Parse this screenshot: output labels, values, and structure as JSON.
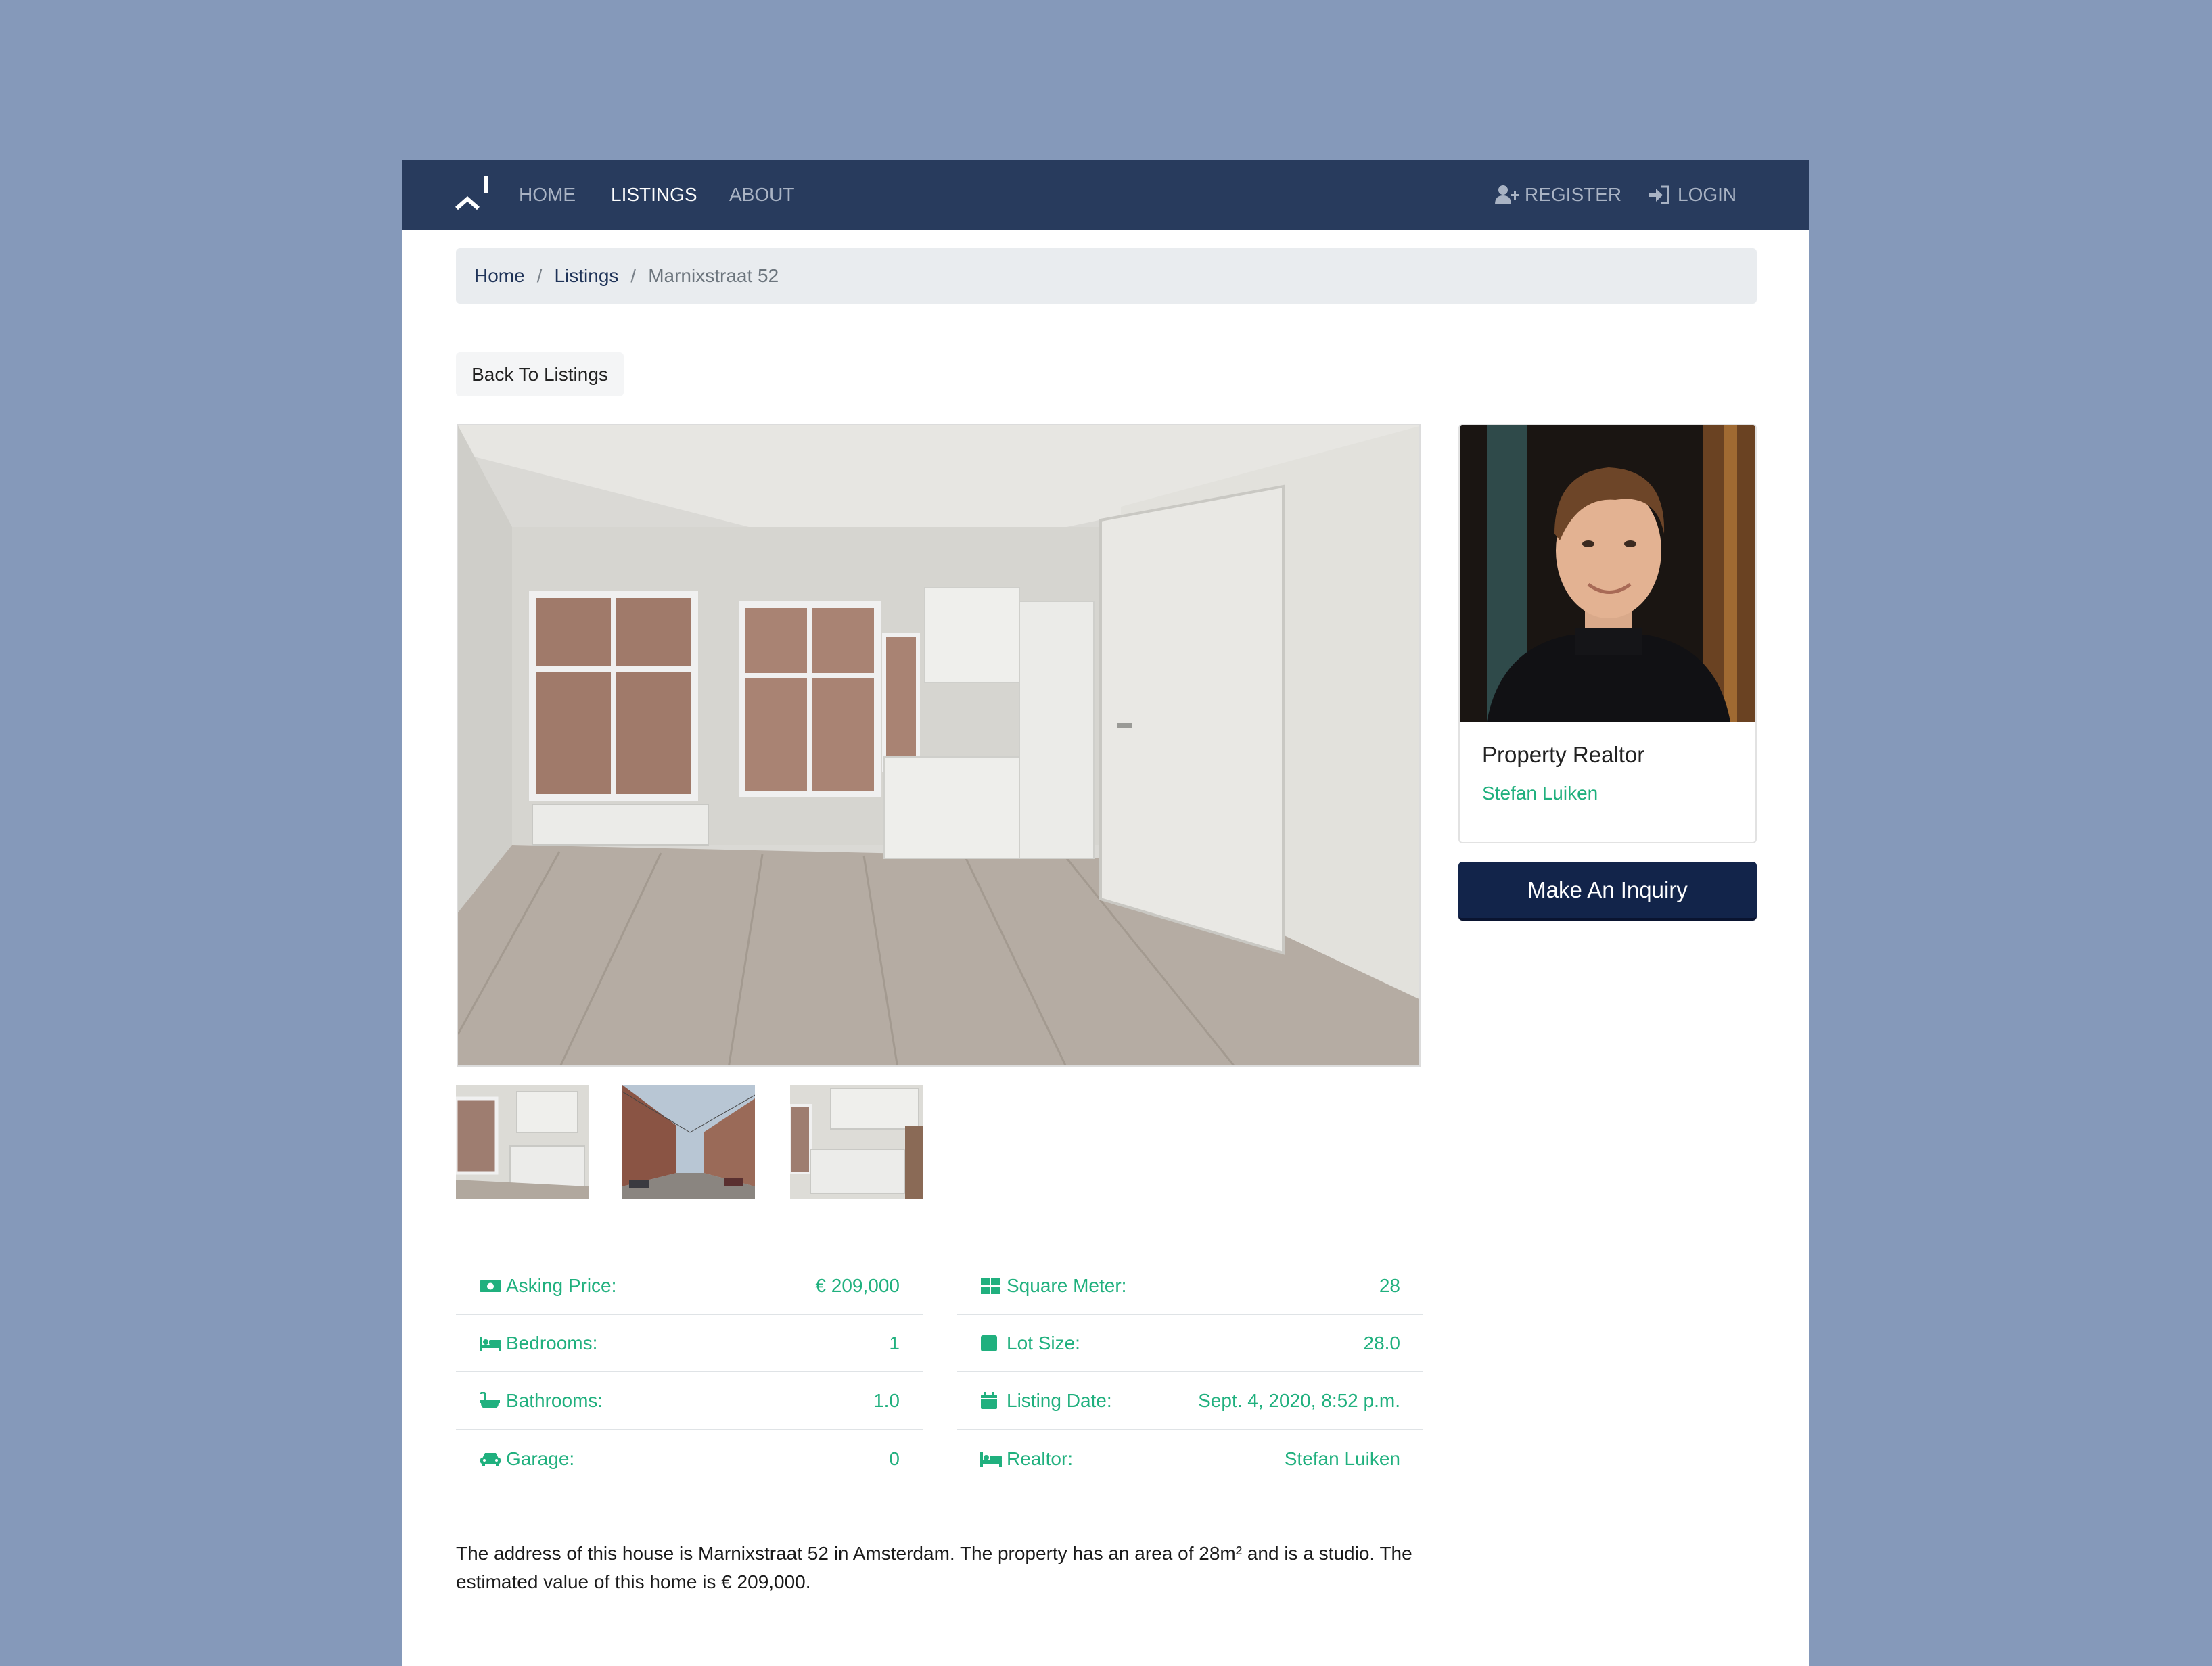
{
  "navbar": {
    "links": [
      "HOME",
      "LISTINGS",
      "ABOUT"
    ],
    "register": "REGISTER",
    "login": "LOGIN"
  },
  "breadcrumb": {
    "home": "Home",
    "listings": "Listings",
    "current": "Marnixstraat 52"
  },
  "back_button": "Back To Listings",
  "realtor": {
    "title": "Property Realtor",
    "name": "Stefan Luiken"
  },
  "inquiry_button": "Make An Inquiry",
  "details_left": [
    {
      "icon": "money-icon",
      "label": "Asking Price:",
      "value": "€ 209,000"
    },
    {
      "icon": "bed-icon",
      "label": "Bedrooms:",
      "value": "1"
    },
    {
      "icon": "bath-icon",
      "label": "Bathrooms:",
      "value": "1.0"
    },
    {
      "icon": "car-icon",
      "label": "Garage:",
      "value": "0"
    }
  ],
  "details_right": [
    {
      "icon": "grid-icon",
      "label": "Square Meter:",
      "value": "28"
    },
    {
      "icon": "square-icon",
      "label": "Lot Size:",
      "value": "28.0"
    },
    {
      "icon": "calendar-icon",
      "label": "Listing Date:",
      "value": "Sept. 4, 2020, 8:52 p.m."
    },
    {
      "icon": "bed-icon",
      "label": "Realtor:",
      "value": "Stefan Luiken"
    }
  ],
  "description": "The address of this house is Marnixstraat 52 in Amsterdam. The property has an area of 28m² and is a studio. The estimated value of this home is € 209,000.",
  "colors": {
    "navbar": "#283b5d",
    "accent_green": "#20b07e",
    "inquiry_button": "#12244a",
    "page_background": "#8599ba"
  }
}
